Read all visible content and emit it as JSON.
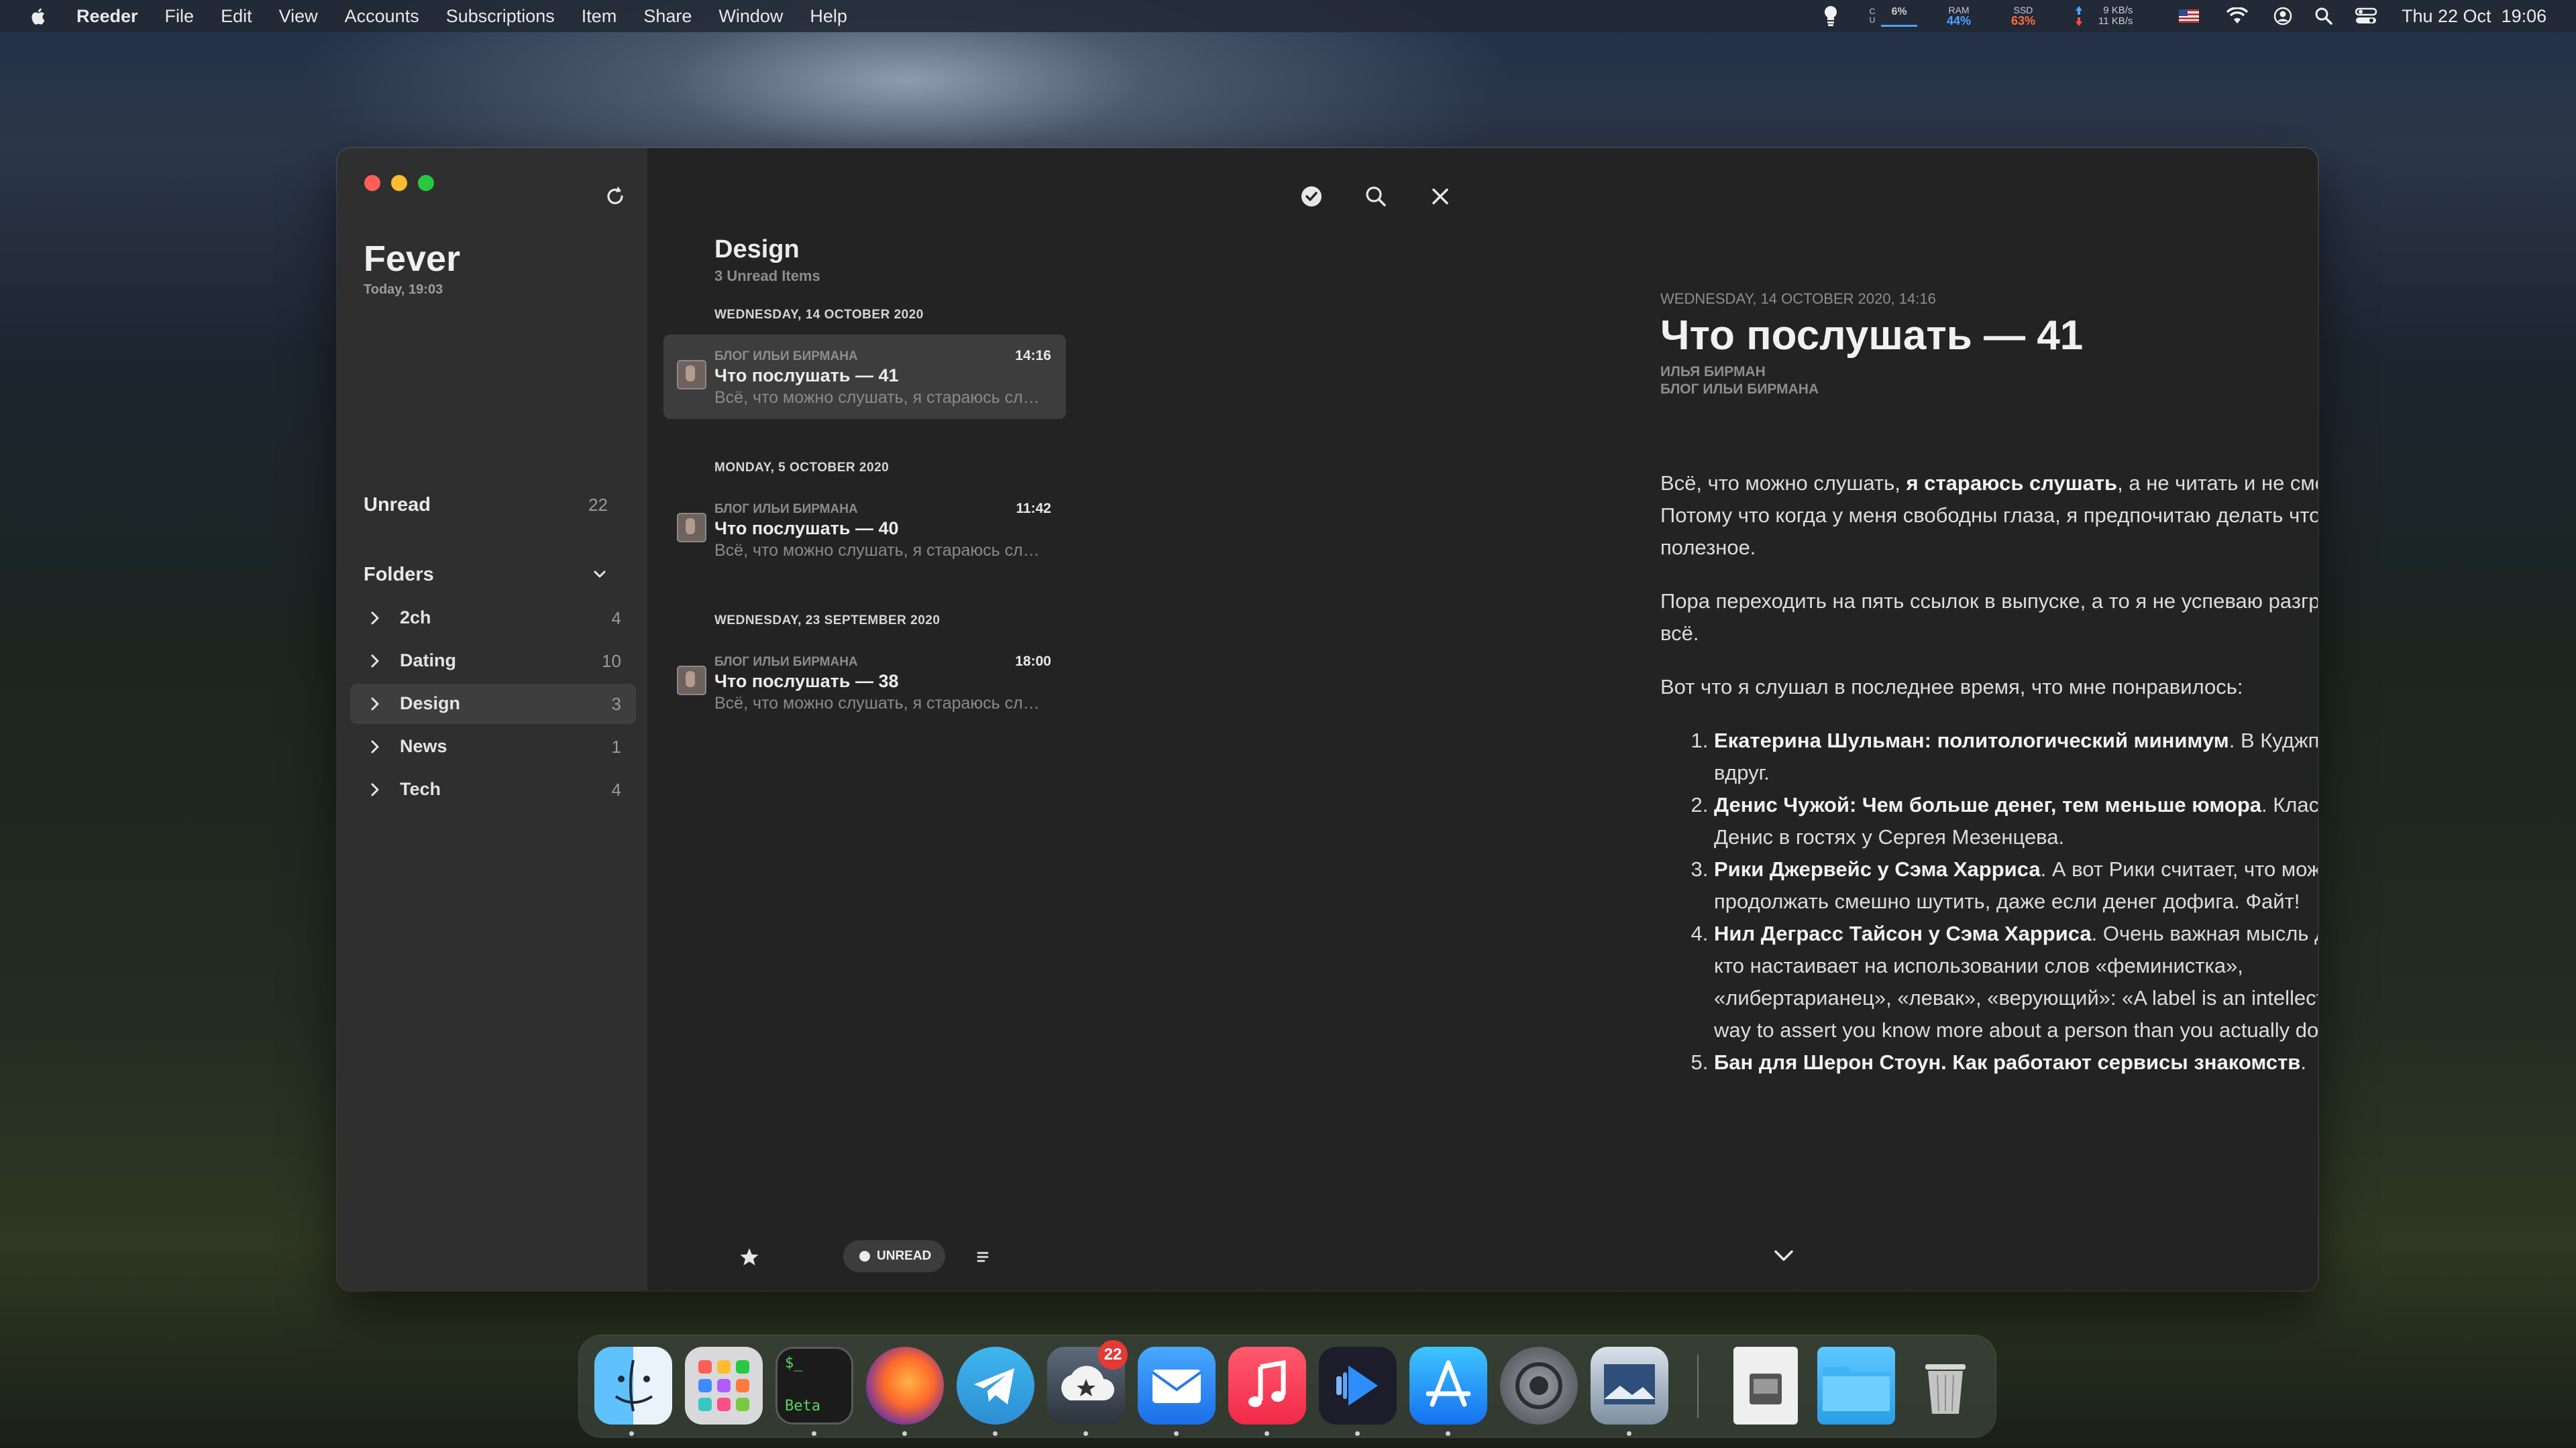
{
  "menubar": {
    "items": [
      "Reeder",
      "File",
      "Edit",
      "View",
      "Accounts",
      "Subscriptions",
      "Item",
      "Share",
      "Window",
      "Help"
    ],
    "cpu_label": "C\nU",
    "cpu_value": "6%",
    "ram_label": "RAM",
    "ram_value": "44%",
    "ssd_label": "SSD",
    "ssd_value": "63%",
    "net_up": "9 KB/s",
    "net_down": "11 KB/s",
    "clock": "Thu 22 Oct  19:06",
    "colors": {
      "ram": "#4aa3ff",
      "ssd": "#ff6b3d"
    }
  },
  "sidebar": {
    "title": "Fever",
    "subtitle": "Today, 19:03",
    "unread_label": "Unread",
    "unread_count": "22",
    "folders_label": "Folders",
    "folders": [
      {
        "label": "2ch",
        "count": "4",
        "selected": false
      },
      {
        "label": "Dating",
        "count": "10",
        "selected": false
      },
      {
        "label": "Design",
        "count": "3",
        "selected": true
      },
      {
        "label": "News",
        "count": "1",
        "selected": false
      },
      {
        "label": "Tech",
        "count": "4",
        "selected": false
      }
    ]
  },
  "list": {
    "title": "Design",
    "subtitle": "3 Unread Items",
    "groups": [
      {
        "date": "WEDNESDAY, 14 OCTOBER 2020",
        "entry": {
          "feed": "БЛОГ ИЛЬИ БИРМАНА",
          "time": "14:16",
          "title": "Что послушать — 41",
          "summary": "Всё, что можно слушать, я стараюсь слушать, а не читать",
          "selected": true
        }
      },
      {
        "date": "MONDAY, 5 OCTOBER 2020",
        "entry": {
          "feed": "БЛОГ ИЛЬИ БИРМАНА",
          "time": "11:42",
          "title": "Что послушать — 40",
          "summary": "Всё, что можно слушать, я стараюсь слушать, а не читать",
          "selected": false
        }
      },
      {
        "date": "WEDNESDAY, 23 SEPTEMBER 2020",
        "entry": {
          "feed": "БЛОГ ИЛЬИ БИРМАНА",
          "time": "18:00",
          "title": "Что послушать — 38",
          "summary": "Всё, что можно слушать, я стараюсь слушать, а не читать",
          "selected": false
        }
      }
    ],
    "unread_filter_label": "UNREAD"
  },
  "toolbar": {
    "bionic_label": "BR"
  },
  "article": {
    "meta": "WEDNESDAY, 14 OCTOBER 2020, 14:16",
    "title": "Что послушать — 41",
    "author": "ИЛЬЯ БИРМАН",
    "feed": "БЛОГ ИЛЬИ БИРМАНА",
    "p1_a": "Всё, что можно слушать, ",
    "p1_b": "я стараюсь слушать",
    "p1_c": ", а не читать и не смотреть. Потому что когда у меня свободны глаза, я предпочитаю делать что-то более полезное.",
    "p2": "Пора переходить на пять ссылок в выпуске, а то я не успеваю разгребать всё.",
    "p3": "Вот что я слушал в последнее время, что мне понравилось:",
    "list": [
      {
        "bold": "Екатерина Шульман: политологический минимум",
        "rest": ". В Кудж­подкасте вдруг."
      },
      {
        "bold": "Денис Чужой: Чем больше денег, тем меньше юмора",
        "rest": ". Классный Денис в гостях у Сергея Мезенцева."
      },
      {
        "bold": "Рики Джервейс у Сэма Харриса",
        "rest": ". А вот Рики считает, что можно продолжать смешно шутить, даже если денег дофига. Файт!"
      },
      {
        "bold": "Нил Деграсс Тайсон у Сэма Харриса",
        "rest": ". Очень важная мысль для тех, кто настаивает на использовании слов «феминистка», «либертарианец», «левак», «верующий»: «A label is an intellectually easy way to assert you know more about a person than you actually do»."
      },
      {
        "bold": "Бан для Шерон Стоун. Как работают сервисы знакомств",
        "rest": "."
      }
    ]
  },
  "dock": {
    "weather_badge": "22",
    "terminal_text": "Beta"
  }
}
